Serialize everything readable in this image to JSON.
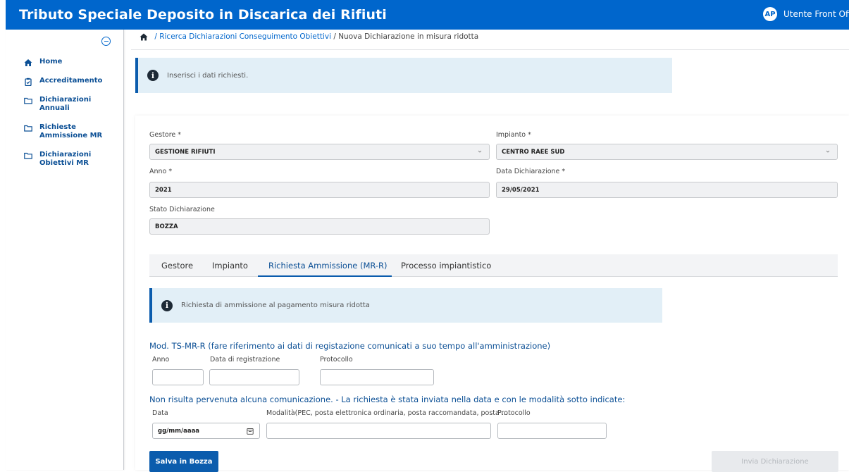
{
  "header": {
    "title": "Tributo Speciale Deposito in Discarica dei Rifiuti",
    "user_initials": "AP",
    "user_name": "Utente Front Office"
  },
  "sidebar": {
    "items": [
      {
        "label": "Home",
        "icon": "home-icon"
      },
      {
        "label": "Accreditamento",
        "icon": "clipboard-icon"
      },
      {
        "label": "Dichiarazioni Annuali",
        "icon": "folder-icon"
      },
      {
        "label": "Richieste Ammissione MR",
        "icon": "folder-icon"
      },
      {
        "label": "Dichiarazioni Obiettivi MR",
        "icon": "folder-icon"
      }
    ]
  },
  "breadcrumb": {
    "separator1": " / ",
    "link": "Ricerca Dichiarazioni Conseguimento Obiettivi",
    "separator2": " / ",
    "current": "Nuova Dichiarazione in misura ridotta"
  },
  "alert_top": {
    "text": "Inserisci i dati richiesti."
  },
  "form": {
    "gestore": {
      "label": "Gestore *",
      "value": "GESTIONE RIFIUTI"
    },
    "impianto": {
      "label": "Impianto *",
      "value": "CENTRO RAEE SUD"
    },
    "anno": {
      "label": "Anno *",
      "value": "2021"
    },
    "data_dichiarazione": {
      "label": "Data Dichiarazione *",
      "value": "29/05/2021"
    },
    "stato": {
      "label": "Stato Dichiarazione",
      "value": "BOZZA"
    }
  },
  "tabs": [
    {
      "label": "Gestore"
    },
    {
      "label": "Impianto"
    },
    {
      "label": "Richiesta Ammissione (MR-R)",
      "active": true
    },
    {
      "label": "Processo impiantistico"
    }
  ],
  "alert_tab": {
    "text": "Richiesta di ammissione al pagamento misura ridotta"
  },
  "section1": {
    "title": "Mod. TS-MR-R (fare riferimento ai dati di registazione comunicati a suo tempo all'amministrazione)",
    "anno_label": "Anno",
    "data_reg_label": "Data di registrazione",
    "protocollo_label": "Protocollo"
  },
  "section2": {
    "title": "Non risulta pervenuta alcuna comunicazione. - La richiesta è stata inviata nella data e con le modalità sotto indicate:",
    "data_label": "Data",
    "data_placeholder": "gg/mm/aaaa",
    "modalita_label": "Modalità(PEC, posta elettronica ordinaria, posta raccomandata, posta ...",
    "protocollo_label": "Protocollo"
  },
  "buttons": {
    "save": "Salva in Bozza",
    "send": "Invia Dichiarazione"
  }
}
